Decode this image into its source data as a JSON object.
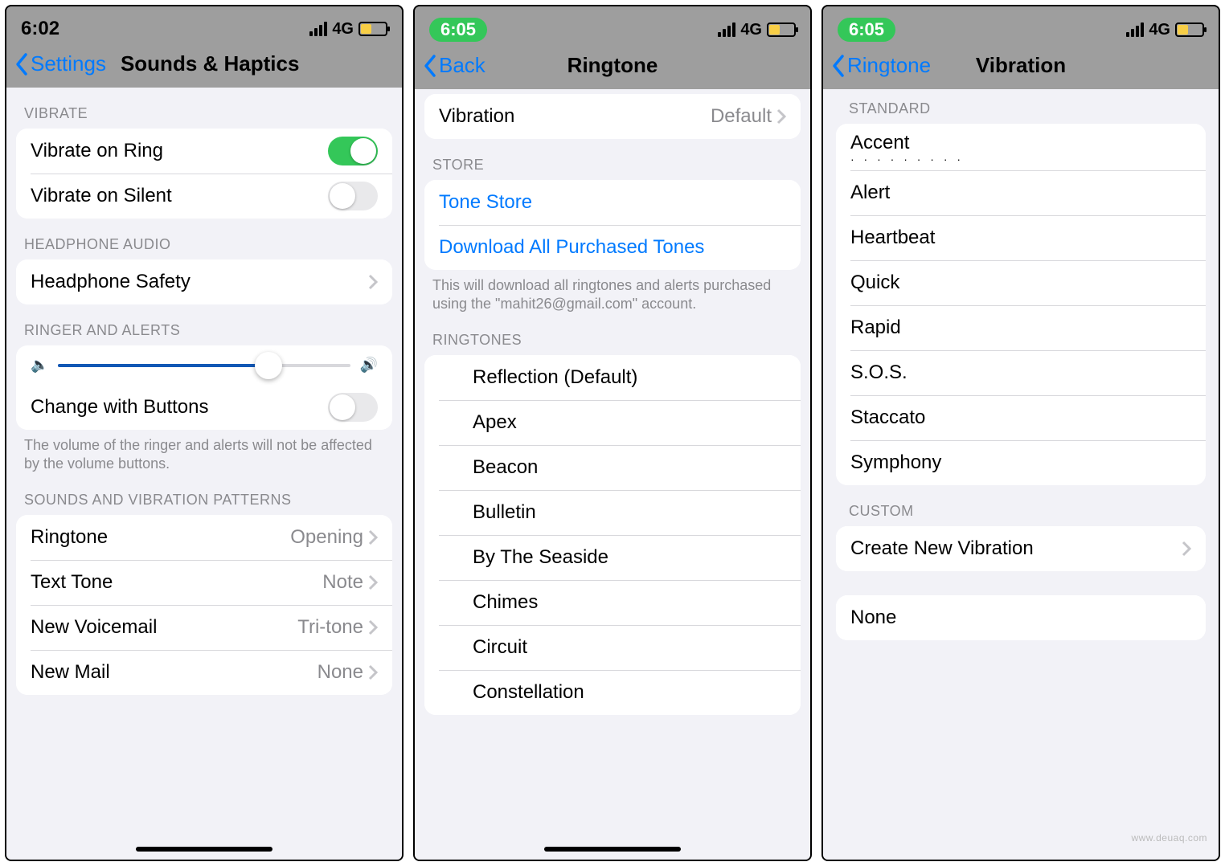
{
  "phone1": {
    "status": {
      "time": "6:02",
      "network": "4G"
    },
    "nav": {
      "back": "Settings",
      "title": "Sounds & Haptics"
    },
    "s_vibrate": {
      "header": "VIBRATE",
      "rows": [
        {
          "label": "Vibrate on Ring",
          "on": true
        },
        {
          "label": "Vibrate on Silent",
          "on": false
        }
      ]
    },
    "s_headphone": {
      "header": "HEADPHONE AUDIO",
      "row": {
        "label": "Headphone Safety"
      }
    },
    "s_ringer": {
      "header": "RINGER AND ALERTS",
      "change_with_buttons": "Change with Buttons",
      "footer": "The volume of the ringer and alerts will not be affected by the volume buttons."
    },
    "s_sounds": {
      "header": "SOUNDS AND VIBRATION PATTERNS",
      "rows": [
        {
          "label": "Ringtone",
          "value": "Opening",
          "highlight": true
        },
        {
          "label": "Text Tone",
          "value": "Note"
        },
        {
          "label": "New Voicemail",
          "value": "Tri-tone"
        },
        {
          "label": "New Mail",
          "value": "None"
        }
      ]
    }
  },
  "phone2": {
    "status": {
      "time": "6:05",
      "network": "4G"
    },
    "nav": {
      "back": "Back",
      "title": "Ringtone"
    },
    "vibration": {
      "label": "Vibration",
      "value": "Default"
    },
    "s_store": {
      "header": "STORE",
      "rows": [
        {
          "label": "Tone Store"
        },
        {
          "label": "Download All Purchased Tones"
        }
      ],
      "footer": "This will download all ringtones and alerts purchased using the \"mahit26@gmail.com\" account."
    },
    "s_ringtones": {
      "header": "RINGTONES",
      "items": [
        "Reflection (Default)",
        "Apex",
        "Beacon",
        "Bulletin",
        "By The Seaside",
        "Chimes",
        "Circuit",
        "Constellation"
      ]
    }
  },
  "phone3": {
    "status": {
      "time": "6:05",
      "network": "4G"
    },
    "nav": {
      "back": "Ringtone",
      "title": "Vibration"
    },
    "s_standard": {
      "header": "STANDARD",
      "items": [
        "Accent",
        "Alert",
        "Heartbeat",
        "Quick",
        "Rapid",
        "S.O.S.",
        "Staccato",
        "Symphony"
      ]
    },
    "s_custom": {
      "header": "CUSTOM",
      "create": "Create New Vibration"
    },
    "none": "None"
  },
  "watermark": "www.deuaq.com"
}
